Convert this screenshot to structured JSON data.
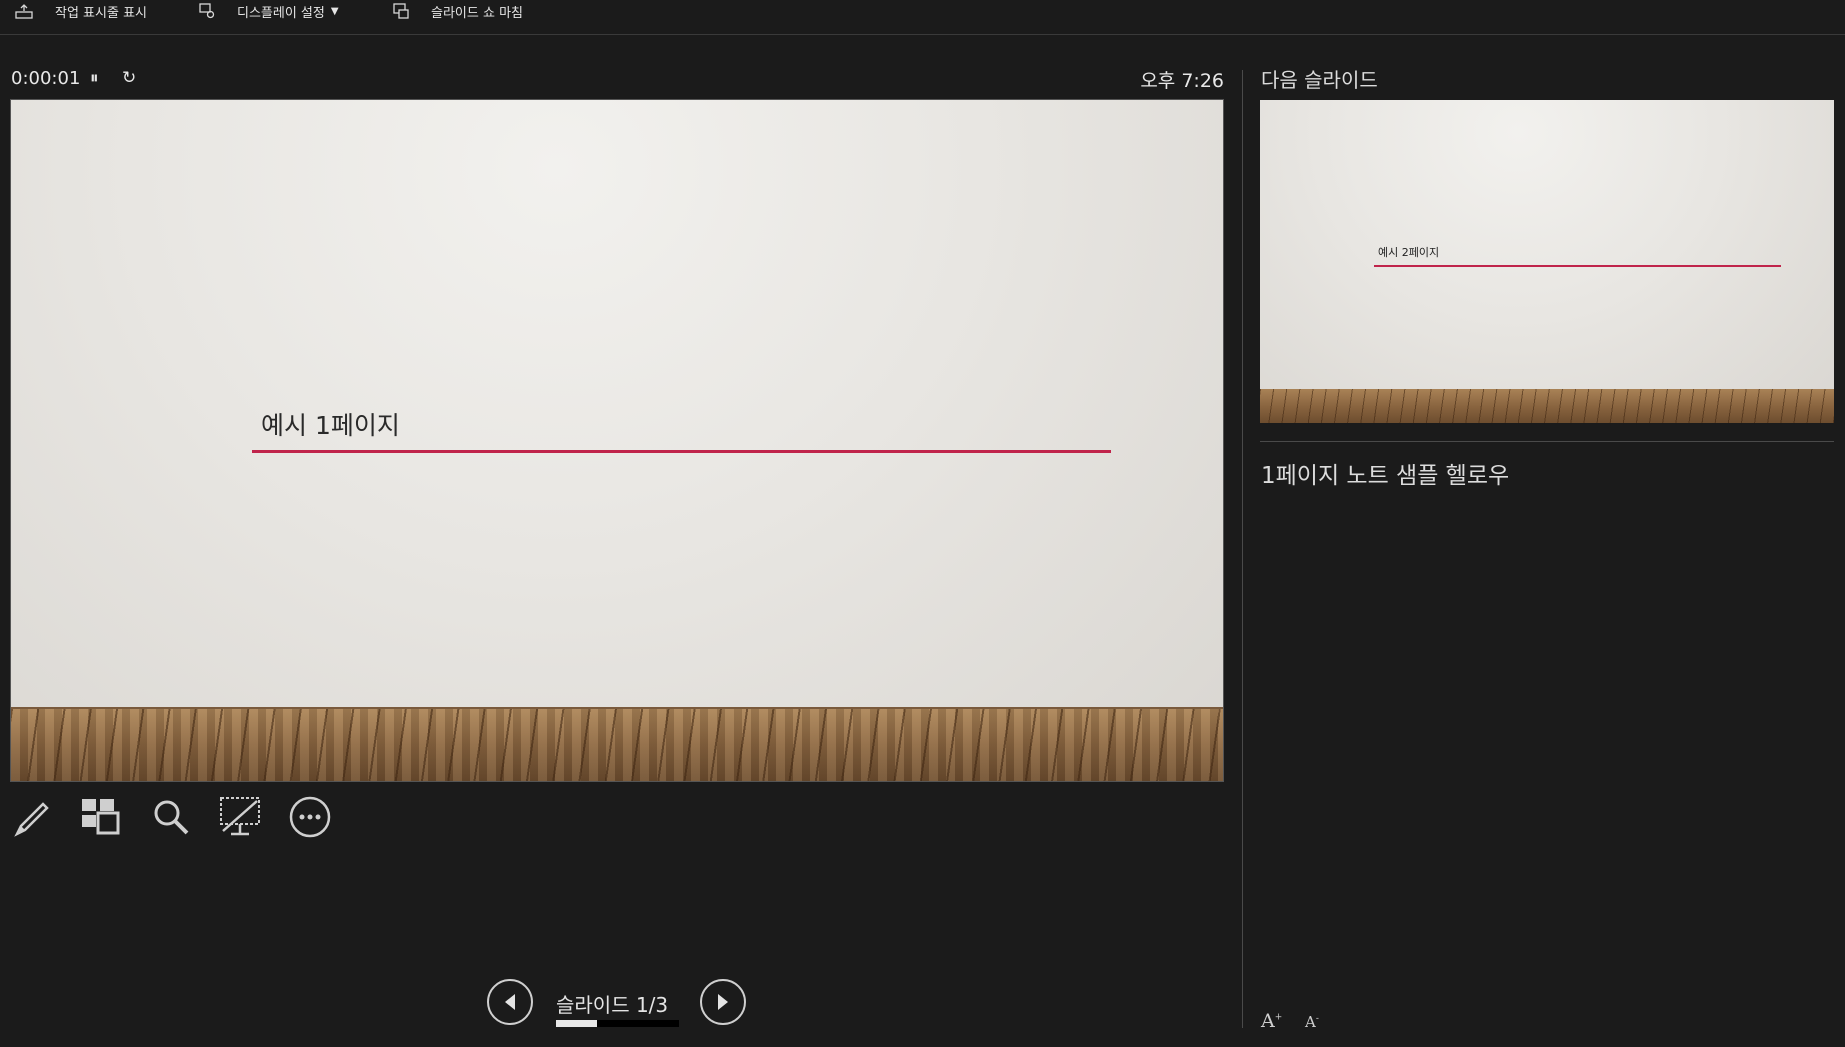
{
  "toolbar": {
    "taskbar_label": "작업 표시줄 표시",
    "display_label": "디스플레이 설정",
    "end_label": "슬라이드 쇼 마침"
  },
  "status": {
    "timer": "0:00:01",
    "clock": "오후 7:26"
  },
  "current_slide": {
    "title": "예시 1페이지",
    "accent_color": "#c0244b"
  },
  "navigation": {
    "slide_counter": "슬라이드 1/3",
    "progress_fraction": 0.333
  },
  "next_slide": {
    "header": "다음 슬라이드",
    "title": "예시 2페이지"
  },
  "notes": {
    "text": "1페이지 노트 샘플 헬로우"
  },
  "tools": [
    "pen-icon",
    "all-slides-icon",
    "zoom-icon",
    "black-screen-icon",
    "more-options-icon"
  ]
}
